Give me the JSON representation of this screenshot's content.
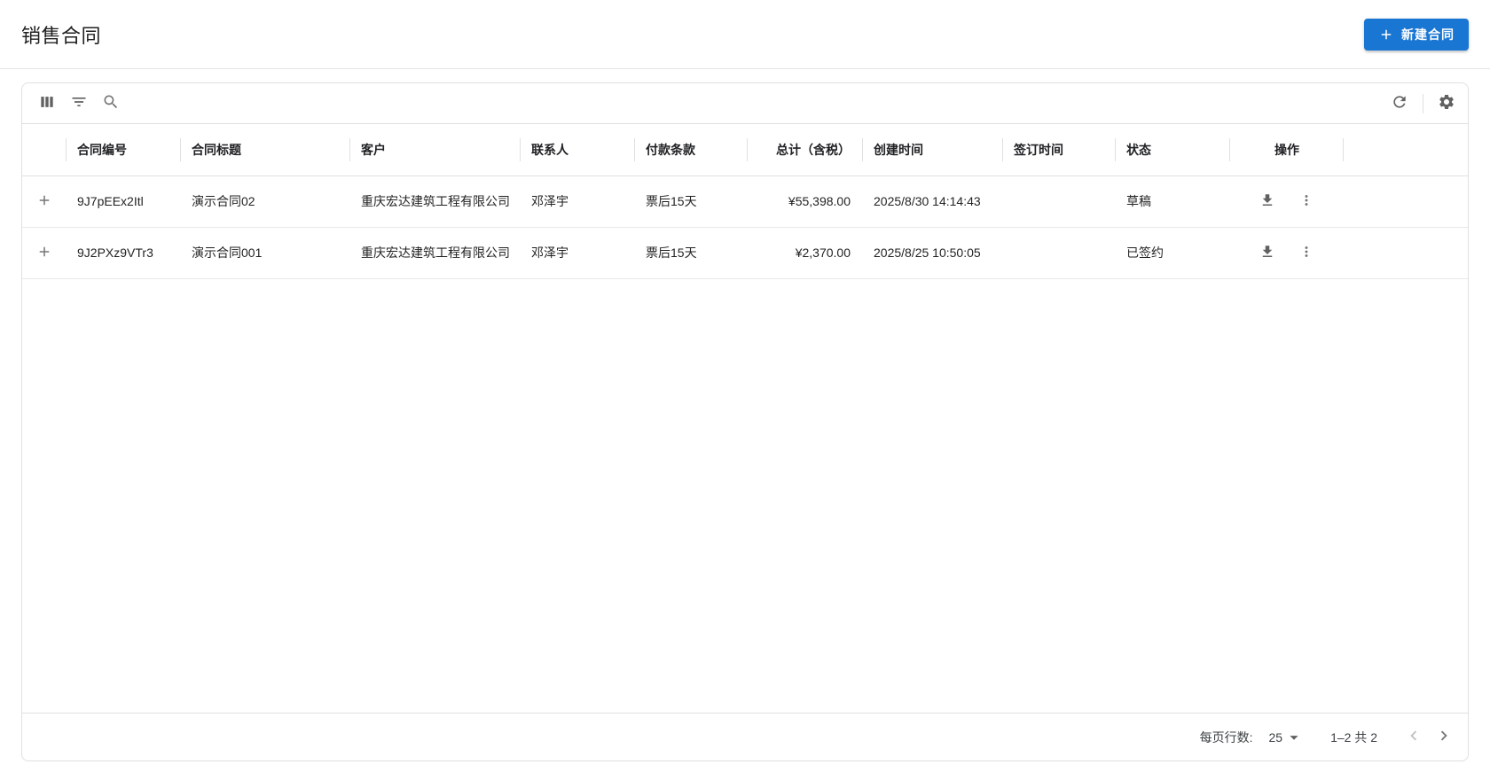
{
  "page": {
    "title": "销售合同"
  },
  "header": {
    "new_contract_label": "新建合同"
  },
  "colors": {
    "primary": "#1976d2",
    "border": "#e0e0e0",
    "text": "#212121"
  },
  "icons": {
    "plus": "＋ cross glyph",
    "view-columns": "three vertical bars",
    "filter-list": "three stacked lines",
    "search": "magnifier",
    "refresh": "circular arrow",
    "settings": "gear",
    "download": "arrow into tray",
    "more-vert": "three vertical dots",
    "arrow-dropdown": "small filled caret",
    "chevron-left": "‹",
    "chevron-right": "›"
  },
  "table": {
    "columns": [
      "合同编号",
      "合同标题",
      "客户",
      "联系人",
      "付款条款",
      "总计（含税）",
      "创建时间",
      "签订时间",
      "状态",
      "操作"
    ],
    "rows": [
      {
        "number": "9J7pEEx2Itl",
        "title": "演示合同02",
        "customer": "重庆宏达建筑工程有限公司",
        "contact": "邓泽宇",
        "payment_terms": "票后15天",
        "total": "¥55,398.00",
        "created_at": "2025/8/30 14:14:43",
        "signed_at": "",
        "status": "草稿"
      },
      {
        "number": "9J2PXz9VTr3",
        "title": "演示合同001",
        "customer": "重庆宏达建筑工程有限公司",
        "contact": "邓泽宇",
        "payment_terms": "票后15天",
        "total": "¥2,370.00",
        "created_at": "2025/8/25 10:50:05",
        "signed_at": "",
        "status": "已签约"
      }
    ]
  },
  "pagination": {
    "rows_per_page_label": "每页行数:",
    "rows_per_page": "25",
    "range_text": "1–2 共 2"
  }
}
